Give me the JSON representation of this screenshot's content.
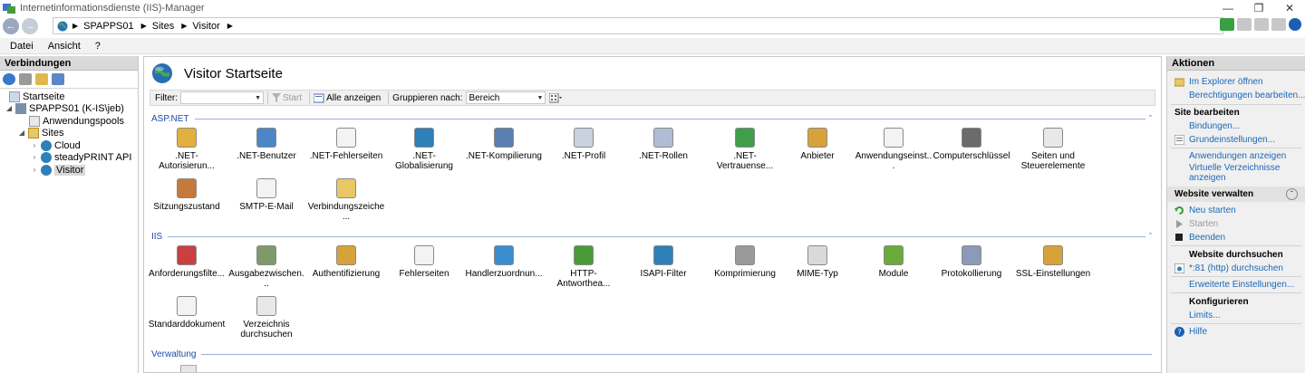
{
  "window": {
    "title": "Internetinformationsdienste (IIS)-Manager"
  },
  "address": {
    "crumbs": [
      "SPAPPS01",
      "Sites",
      "Visitor"
    ]
  },
  "menu": [
    "Datei",
    "Ansicht",
    "?"
  ],
  "connections": {
    "header": "Verbindungen",
    "tree": [
      {
        "label": "Startseite"
      },
      {
        "label": "SPAPPS01 (K-IS\\jeb)"
      },
      {
        "label": "Anwendungspools"
      },
      {
        "label": "Sites"
      },
      {
        "label": "Cloud"
      },
      {
        "label": "steadyPRINT API"
      },
      {
        "label": "Visitor"
      }
    ]
  },
  "center": {
    "title": "Visitor Startseite",
    "filter": {
      "label": "Filter:",
      "start": "Start",
      "show_all": "Alle anzeigen",
      "group_label": "Gruppieren nach:",
      "group_value": "Bereich"
    },
    "sections": [
      {
        "name": "ASP.NET"
      },
      {
        "name": "IIS"
      },
      {
        "name": "Verwaltung"
      }
    ],
    "aspnet": [
      ".NET-Autorisierun...",
      ".NET-Benutzer",
      ".NET-Fehlerseiten",
      ".NET-Globalisierung",
      ".NET-Kompilierung",
      ".NET-Profil",
      ".NET-Rollen",
      ".NET-Vertrauense...",
      "Anbieter",
      "Anwendungseinst...",
      "Computerschlüssel",
      "Seiten und Steuerelemente",
      "Sitzungszustand",
      "SMTP-E-Mail",
      "Verbindungszeiche..."
    ],
    "iis": [
      "Anforderungsfilte...",
      "Ausgabezwischen...",
      "Authentifizierung",
      "Fehlerseiten",
      "Handlerzuordnun...",
      "HTTP-Antworthea...",
      "ISAPI-Filter",
      "Komprimierung",
      "MIME-Typ",
      "Module",
      "Protokollierung",
      "SSL-Einstellungen",
      "Standarddokument",
      "Verzeichnis durchsuchen"
    ]
  },
  "actions": {
    "header": "Aktionen",
    "explore": "Im Explorer öffnen",
    "perms": "Berechtigungen bearbeiten...",
    "edit_site": "Site bearbeiten",
    "bindings": "Bindungen...",
    "basic": "Grundeinstellungen...",
    "view_apps": "Anwendungen anzeigen",
    "view_vdirs": "Virtuelle Verzeichnisse anzeigen",
    "manage": "Website verwalten",
    "restart": "Neu starten",
    "start": "Starten",
    "stop": "Beenden",
    "browse_head": "Website durchsuchen",
    "browse_link": "*:81 (http) durchsuchen",
    "advanced": "Erweiterte Einstellungen...",
    "configure": "Konfigurieren",
    "limits": "Limits...",
    "help": "Hilfe"
  }
}
